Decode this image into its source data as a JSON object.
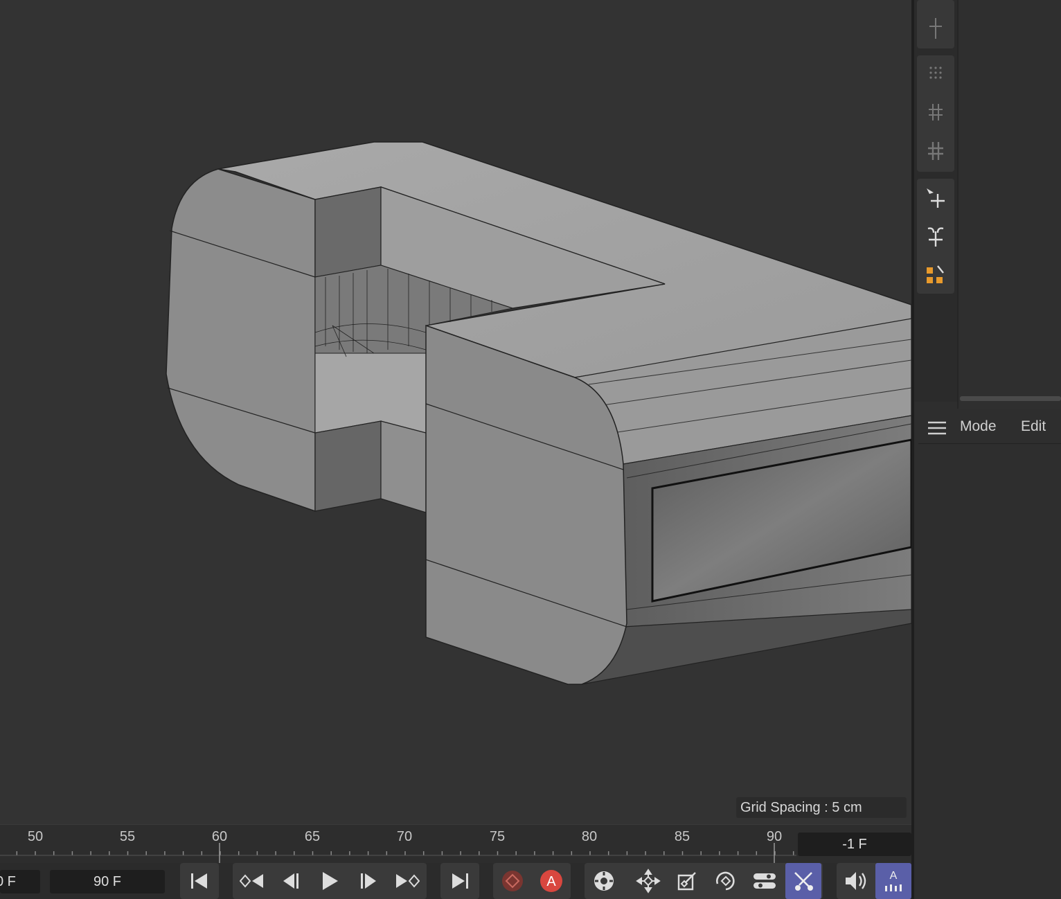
{
  "viewport": {
    "grid_spacing": "Grid Spacing : 5 cm"
  },
  "attributes": {
    "menu": [
      "Mode",
      "Edit"
    ]
  },
  "timeline": {
    "ticks": [
      "50",
      "55",
      "60",
      "65",
      "70",
      "75",
      "80",
      "85",
      "90"
    ],
    "current_frame": "-1 F",
    "start_frame": "0 F",
    "end_frame": "90 F"
  },
  "colors": {
    "viewport_bg": "#333333",
    "accent_blue": "#5a5fa8",
    "record_red": "#d9473f"
  },
  "icons": {
    "toolbar": [
      "snap-icon",
      "grid-dots-icon",
      "grid-small-icon",
      "grid-large-icon",
      "move-icon",
      "scale-icon",
      "object-axis-icon"
    ],
    "transport": [
      "go-to-start-icon",
      "prev-key-icon",
      "prev-frame-icon",
      "play-icon",
      "next-frame-icon",
      "next-key-icon",
      "go-to-end-icon",
      "record-key-icon",
      "autokey-icon",
      "settings-icon",
      "position-key-icon",
      "scale-key-icon",
      "rotation-key-icon",
      "param-key-icon",
      "pla-key-icon",
      "sound-icon",
      "keyframe-interp-icon"
    ]
  }
}
